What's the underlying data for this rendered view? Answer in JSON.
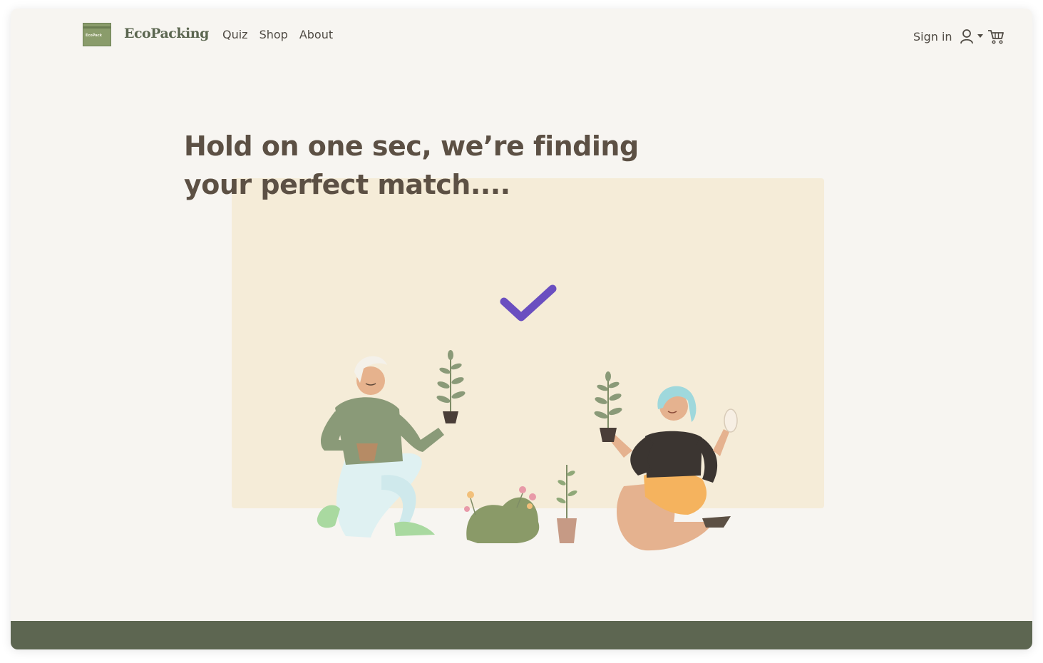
{
  "header": {
    "brand": "EcoPacking",
    "logo_text": "EcoPack",
    "nav": [
      "Quiz",
      "Shop",
      "About"
    ],
    "sign_in": "Sign in",
    "icons": [
      "user-icon",
      "caret-down-icon",
      "cart-icon"
    ]
  },
  "main": {
    "headline_line1": "Hold on one sec, we’re finding",
    "headline_line2": "your perfect match....",
    "status_icon": "checkmark-icon"
  },
  "colors": {
    "page_bg": "#f7f5f1",
    "panel_bg": "#f5ecd8",
    "heading": "#5c5044",
    "brand_green": "#5b6650",
    "footer": "#5d6651",
    "accent_check": "#6a4fc0"
  }
}
